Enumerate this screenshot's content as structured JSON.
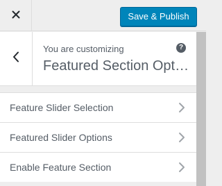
{
  "header": {
    "close_icon": "close-icon",
    "save_label": "Save & Publish",
    "save_color": "#0085ba"
  },
  "section": {
    "back_icon": "chevron-left-icon",
    "customizing_label": "You are customizing",
    "help_icon": "help-icon",
    "help_glyph": "?",
    "title": "Featured Section Options"
  },
  "controls": [
    {
      "label": "Feature Slider Selection",
      "icon": "chevron-right-icon"
    },
    {
      "label": "Featured Slider Options",
      "icon": "chevron-right-icon"
    },
    {
      "label": "Enable Feature Section",
      "icon": "chevron-right-icon"
    }
  ]
}
